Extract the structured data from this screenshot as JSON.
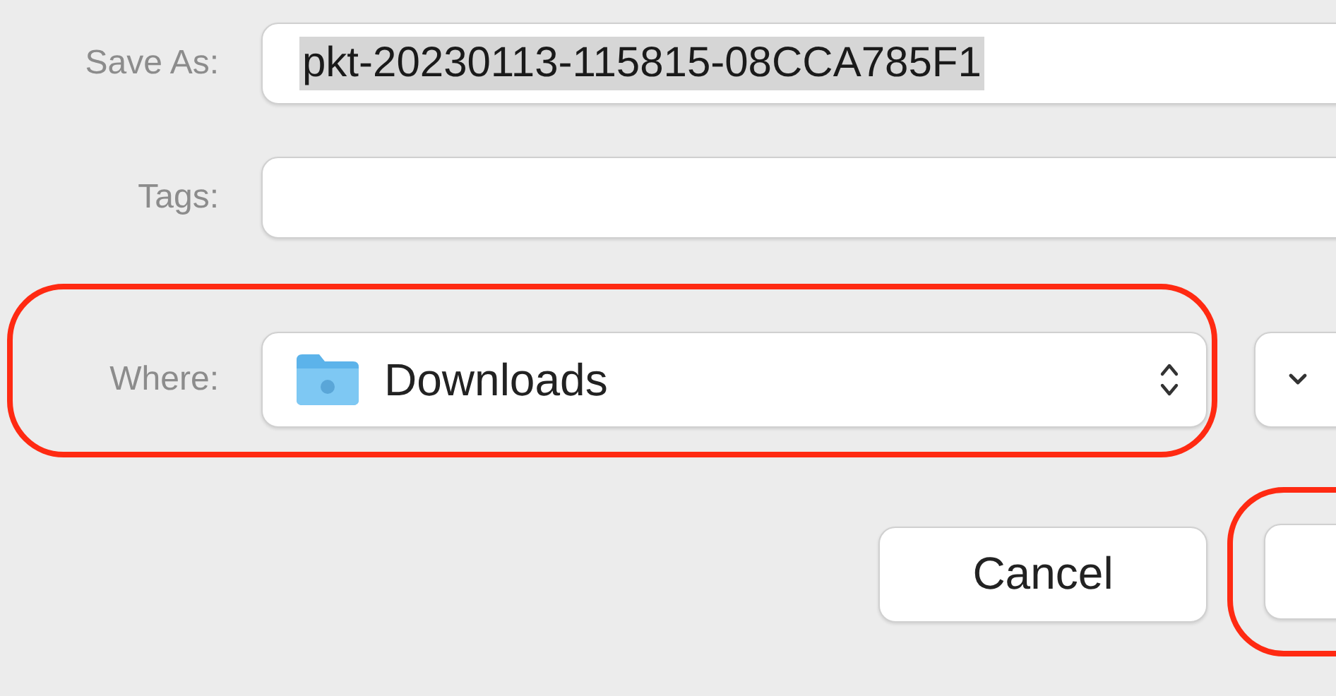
{
  "save_as": {
    "label": "Save As:",
    "value": "pkt-20230113-115815-08CCA785F1",
    "text_selected": true
  },
  "tags": {
    "label": "Tags:"
  },
  "where": {
    "label": "Where:",
    "value": "Downloads",
    "highlighted": true
  },
  "buttons": [
    {
      "label": "Cancel",
      "kind": "cancel"
    },
    {
      "kind": "default",
      "highlighted": true
    }
  ]
}
